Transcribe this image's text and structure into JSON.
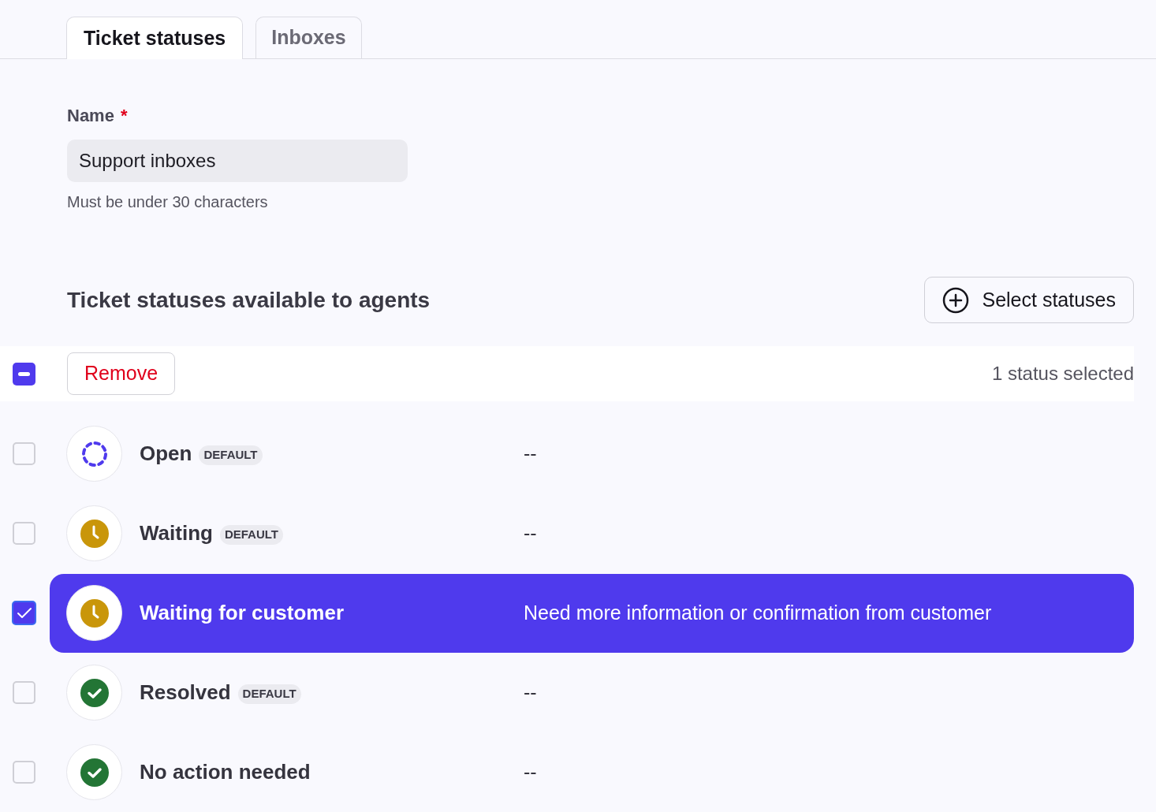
{
  "tabs": [
    {
      "label": "Ticket statuses",
      "selected": true
    },
    {
      "label": "Inboxes",
      "selected": false
    }
  ],
  "name_field": {
    "label": "Name",
    "required_mark": "*",
    "value": "Support inboxes",
    "hint": "Must be under 30 characters"
  },
  "section": {
    "title": "Ticket statuses available to agents",
    "select_button": "Select statuses"
  },
  "bulk_bar": {
    "indeterminate": true,
    "remove_button": "Remove",
    "count": "1 status selected"
  },
  "statuses": [
    {
      "name": "Open",
      "badge": "DEFAULT",
      "description": "--",
      "kind": "dashed",
      "color": "#4f3aed",
      "selected": false
    },
    {
      "name": "Waiting",
      "badge": "DEFAULT",
      "description": "--",
      "kind": "clock",
      "color": "#c9960a",
      "selected": false
    },
    {
      "name": "Waiting for customer",
      "description": "Need more information or confirmation from customer",
      "kind": "clock",
      "color": "#c9960a",
      "selected": true
    },
    {
      "name": "Resolved",
      "badge": "DEFAULT",
      "description": "--",
      "kind": "check",
      "color": "#237535",
      "selected": false
    },
    {
      "name": "No action needed",
      "description": "--",
      "kind": "check",
      "color": "#237535",
      "selected": false
    }
  ]
}
